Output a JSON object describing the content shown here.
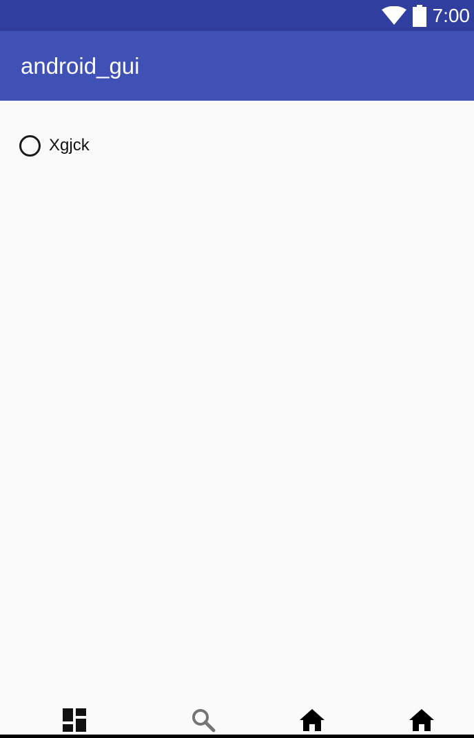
{
  "status_bar": {
    "time": "7:00",
    "icons": [
      "wifi-icon",
      "battery-icon"
    ],
    "background": "#303f9f"
  },
  "app_bar": {
    "title": "android_gui",
    "background": "#3f51b5"
  },
  "content": {
    "radio_options": [
      {
        "label": "Xgjck",
        "checked": false
      }
    ]
  },
  "bottom_nav": {
    "items": [
      {
        "icon": "dashboard-icon"
      },
      {
        "icon": "search-icon"
      },
      {
        "icon": "home-icon"
      },
      {
        "icon": "home-icon"
      }
    ]
  }
}
